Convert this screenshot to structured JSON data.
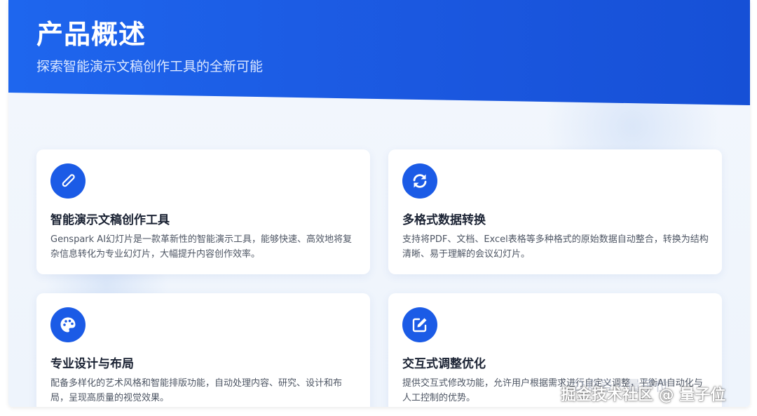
{
  "header": {
    "title": "产品概述",
    "subtitle": "探索智能演示文稿创作工具的全新可能"
  },
  "cards": [
    {
      "icon": "pen-icon",
      "title": "智能演示文稿创作工具",
      "description": "Genspark AI幻灯片是一款革新性的智能演示工具，能够快速、高效地将复杂信息转化为专业幻灯片，大幅提升内容创作效率。"
    },
    {
      "icon": "sync-icon",
      "title": "多格式数据转换",
      "description": "支持将PDF、文档、Excel表格等多种格式的原始数据自动整合，转换为结构清晰、易于理解的会议幻灯片。"
    },
    {
      "icon": "palette-icon",
      "title": "专业设计与布局",
      "description": "配备多样化的艺术风格和智能排版功能，自动处理内容、研究、设计和布局，呈现高质量的视觉效果。"
    },
    {
      "icon": "edit-icon",
      "title": "交互式调整优化",
      "description": "提供交互式修改功能，允许用户根据需求进行自定义调整，平衡AI自动化与人工控制的优势。"
    }
  ],
  "watermark": {
    "text": "掘金技术社区 @ 量子位",
    "faint_text": "公众号 · 量子位"
  },
  "colors": {
    "accent": "#1b5be6",
    "header_start": "#1e66ee",
    "header_end": "#1650d6"
  }
}
